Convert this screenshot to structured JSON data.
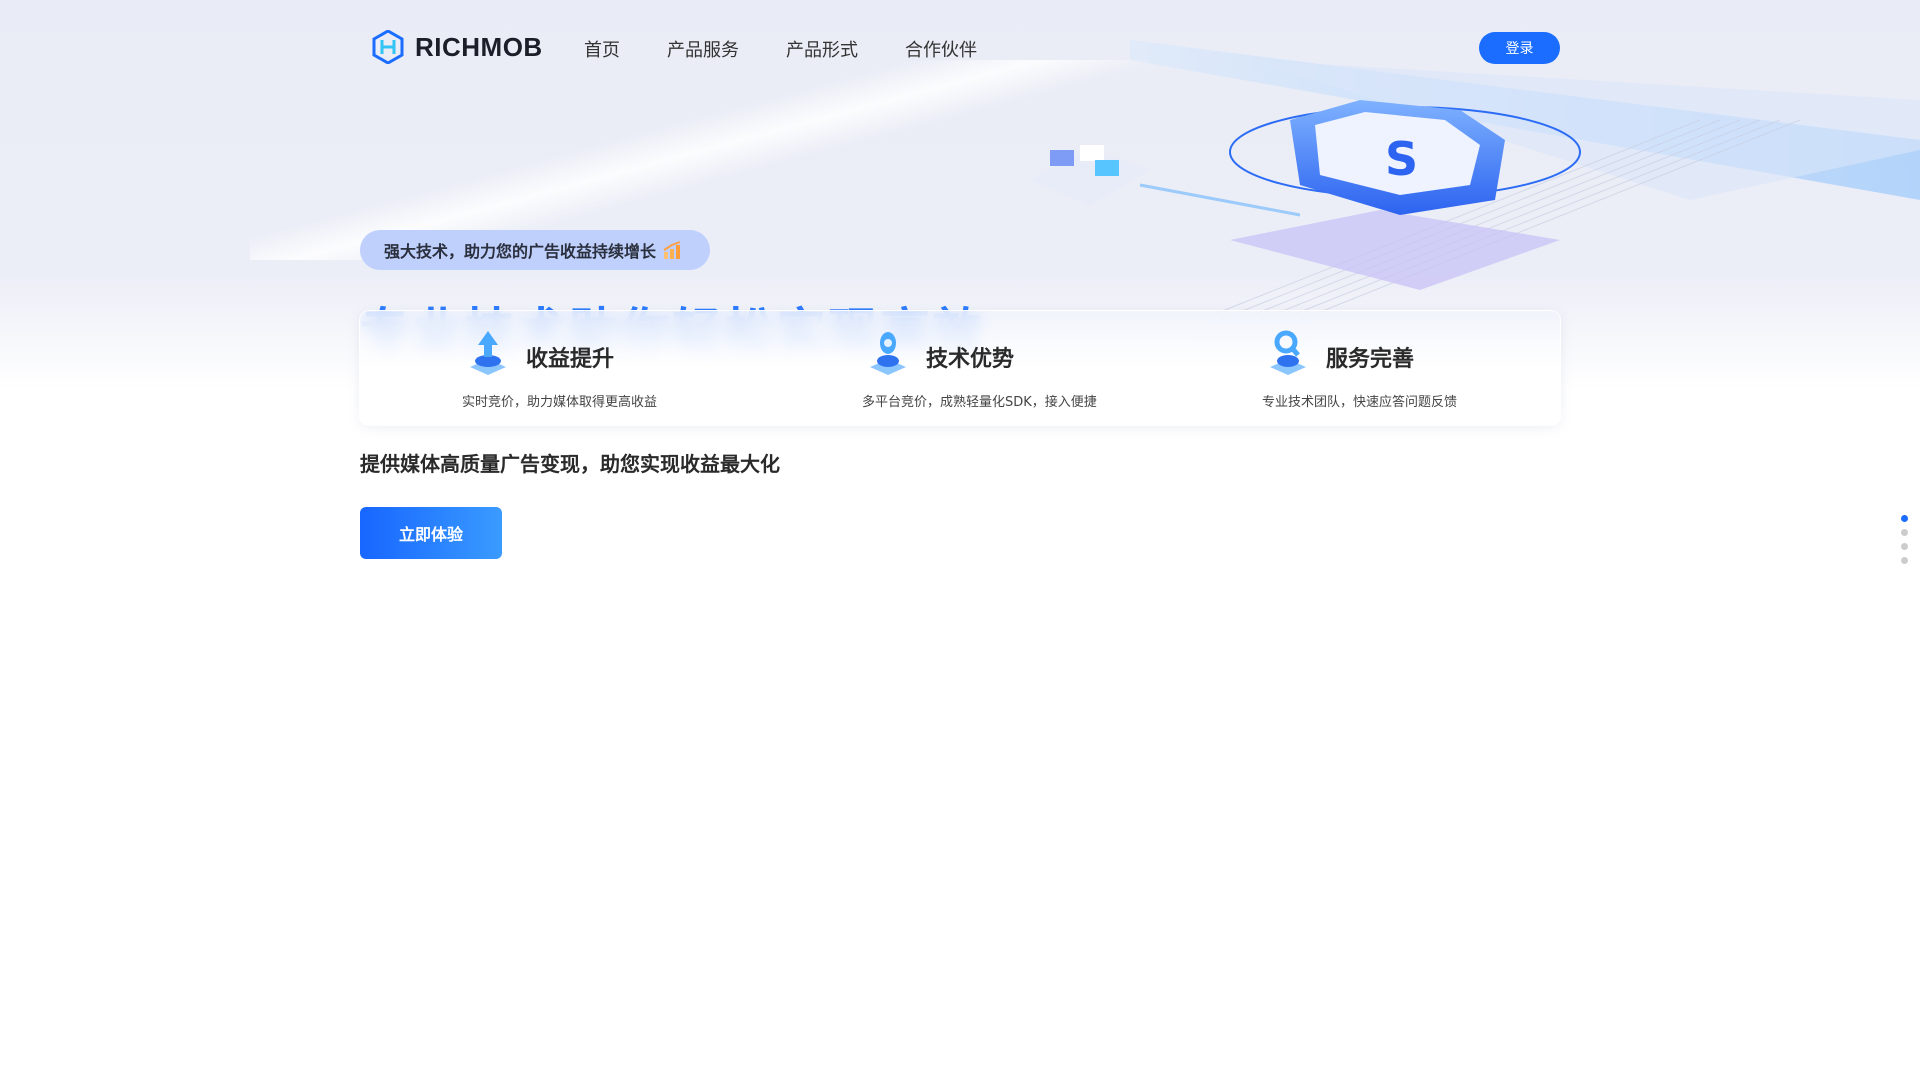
{
  "header": {
    "brand": "RICHMOB",
    "nav": [
      "首页",
      "产品服务",
      "产品形式",
      "合作伙伴"
    ],
    "login_label": "登录"
  },
  "hero": {
    "tag": "强大技术，助力您的广告收益持续增长",
    "headline": "专业技术助你轻松实现高效",
    "subtitle": "提供媒体高质量广告变现，助您实现收益最大化",
    "cta_label": "立即体验"
  },
  "features": [
    {
      "title": "收益提升",
      "desc": "实时竞价，助力媒体取得更高收益",
      "icon": "chart-up-icon"
    },
    {
      "title": "技术优势",
      "desc": "多平台竞价，成熟轻量化SDK，接入便捷",
      "icon": "tech-icon"
    },
    {
      "title": "服务完善",
      "desc": "专业技术团队，快速应答问题反馈",
      "icon": "support-icon"
    }
  ],
  "pager": {
    "count": 4,
    "active": 1
  },
  "colors": {
    "accent": "#1a6dff",
    "tag_bg": "#bfd0fd"
  }
}
